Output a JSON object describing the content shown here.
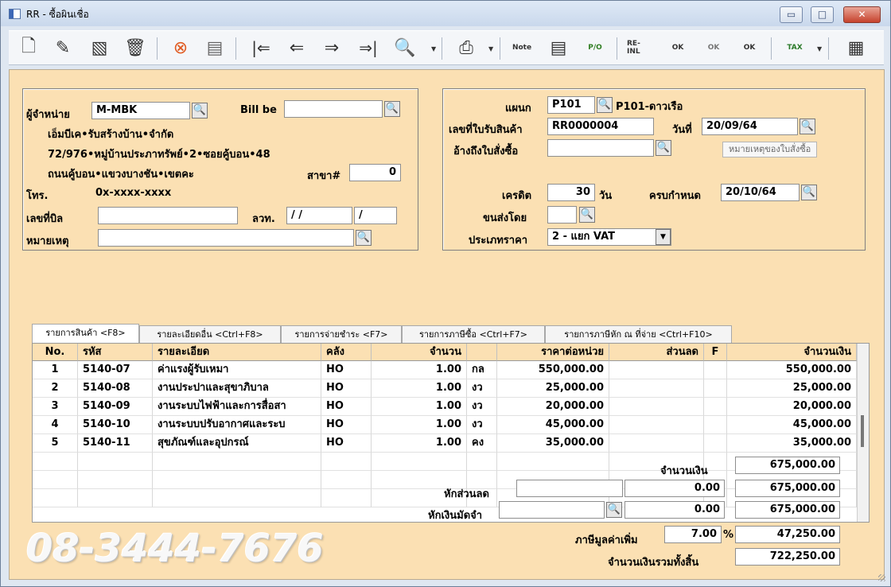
{
  "window": {
    "title": "RR - ซื้อผินเชื่อ",
    "minimize": "▭",
    "maximize": "□",
    "close": "✕"
  },
  "toolbar": [
    {
      "name": "new-document-icon",
      "glyph": "🗋"
    },
    {
      "name": "edit-icon",
      "glyph": "✎"
    },
    {
      "name": "void-icon",
      "glyph": "▧"
    },
    {
      "name": "delete-trash-icon",
      "glyph": "🗑"
    },
    {
      "name": "cancel-icon",
      "glyph": "⊗"
    },
    {
      "name": "save-icon",
      "glyph": "▤"
    },
    {
      "name": "first-record-icon",
      "glyph": "|⇐"
    },
    {
      "name": "previous-record-icon",
      "glyph": "⇐"
    },
    {
      "name": "next-record-icon",
      "glyph": "⇒"
    },
    {
      "name": "last-record-icon",
      "glyph": "⇒|"
    },
    {
      "name": "search-icon",
      "glyph": "🔍"
    },
    {
      "name": "print-icon",
      "glyph": "⎙"
    },
    {
      "name": "note-icon",
      "glyph": "Note"
    },
    {
      "name": "register-icon",
      "glyph": "▤"
    },
    {
      "name": "po-icon",
      "glyph": "P/O"
    },
    {
      "name": "keyboard-icon",
      "glyph": "⌨"
    },
    {
      "name": "return-icon",
      "glyph": "RE-INL"
    },
    {
      "name": "approve-ok-icon",
      "glyph": "OK"
    },
    {
      "name": "link-ok-icon",
      "glyph": "OK"
    },
    {
      "name": "document-ok-icon",
      "glyph": "OK"
    },
    {
      "name": "tax-print-icon",
      "glyph": "TAX"
    },
    {
      "name": "settings-sheet-icon",
      "glyph": "▦"
    }
  ],
  "vendor": {
    "label": "ผู้จำหน่าย",
    "code": "M-MBK",
    "bill_label": "Bill be",
    "bill_value": "",
    "name": "เอ็มบีเค•รับสร้างบ้าน•จำกัด",
    "address1": "72/976•หมู่บ้านประภาทรัพย์•2•ซอยคู้บอน•48",
    "address2": "ถนนคู้บอน•แขวงบางชัน•เขตคะ",
    "branch_label": "สาขา#",
    "branch_value": "0",
    "phone_label": "โทร.",
    "phone_value": "0x-xxxx-xxxx",
    "bill_no_label": "เลขที่บิล",
    "bill_no_value": "",
    "date_label": "ลวท.",
    "date_value": "/  /",
    "date_value2": "/",
    "remark_label": "หมายเหตุ",
    "remark_value": ""
  },
  "receipt": {
    "department_label": "แผนก",
    "department_code": "P101",
    "department_name": "P101-ดาวเรือ",
    "receipt_no_label": "เลขที่ใบรับสินค้า",
    "receipt_no_value": "RR0000004",
    "date_label": "วันที่",
    "date_value": "20/09/64",
    "po_ref_label": "อ้างถึงใบสั่งซื้อ",
    "po_ref_value": "",
    "po_note": "หมายเหตุของใบสั่งซื้อ",
    "credit_label": "เครดิต",
    "credit_value": "30",
    "credit_unit": "วัน",
    "due_label": "ครบกำหนด",
    "due_value": "20/10/64",
    "shipping_label": "ขนส่งโดย",
    "shipping_value": "",
    "price_type_label": "ประเภทราคา",
    "price_type_value": "2 - แยก VAT"
  },
  "tabs": [
    "รายการสินค้า <F8>",
    "รายละเอียดอื่น <Ctrl+F8>",
    "รายการจ่ายชำระ <F7>",
    "รายการภาษีซื้อ <Ctrl+F7>",
    "รายการภาษีหัก ณ ที่จ่าย <Ctrl+F10>"
  ],
  "table": {
    "headers": [
      "No.",
      "รหัส",
      "รายละเอียด",
      "คลัง",
      "จำนวน",
      "",
      "ราคาต่อหน่วย",
      "ส่วนลด",
      "F",
      "จำนวนเงิน"
    ],
    "rows": [
      [
        "1",
        "5140-07",
        "ค่าแรงผู้รับเหมา",
        "HO",
        "1.00",
        "กล",
        "550,000.00",
        "",
        "",
        "550,000.00"
      ],
      [
        "2",
        "5140-08",
        "งานประปาและสุขาภิบาล",
        "HO",
        "1.00",
        "งว",
        "25,000.00",
        "",
        "",
        "25,000.00"
      ],
      [
        "3",
        "5140-09",
        "งานระบบไฟฟ้าและการสื่อสา",
        "HO",
        "1.00",
        "งว",
        "20,000.00",
        "",
        "",
        "20,000.00"
      ],
      [
        "4",
        "5140-10",
        "งานระบบปรับอากาศและระบ",
        "HO",
        "1.00",
        "งว",
        "45,000.00",
        "",
        "",
        "45,000.00"
      ],
      [
        "5",
        "5140-11",
        "สุขภัณฑ์และอุปกรณ์",
        "HO",
        "1.00",
        "คง",
        "35,000.00",
        "",
        "",
        "35,000.00"
      ]
    ]
  },
  "summary": {
    "amount_label": "จำนวนเงิน",
    "amount_value": "675,000.00",
    "discount_label": "หักส่วนลด",
    "discount_input": "",
    "discount_value": "0.00",
    "discount_after": "675,000.00",
    "deposit_label": "หักเงินมัดจำ",
    "deposit_input": "",
    "deposit_value": "0.00",
    "deposit_after": "675,000.00",
    "vat_label": "ภาษีมูลค่าเพิ่ม",
    "vat_rate": "7.00",
    "vat_percent": "%",
    "vat_value": "47,250.00",
    "total_label": "จำนวนเงินรวมทั้งสิ้น",
    "total_value": "722,250.00"
  },
  "phone_watermark": "08-3444-7676"
}
